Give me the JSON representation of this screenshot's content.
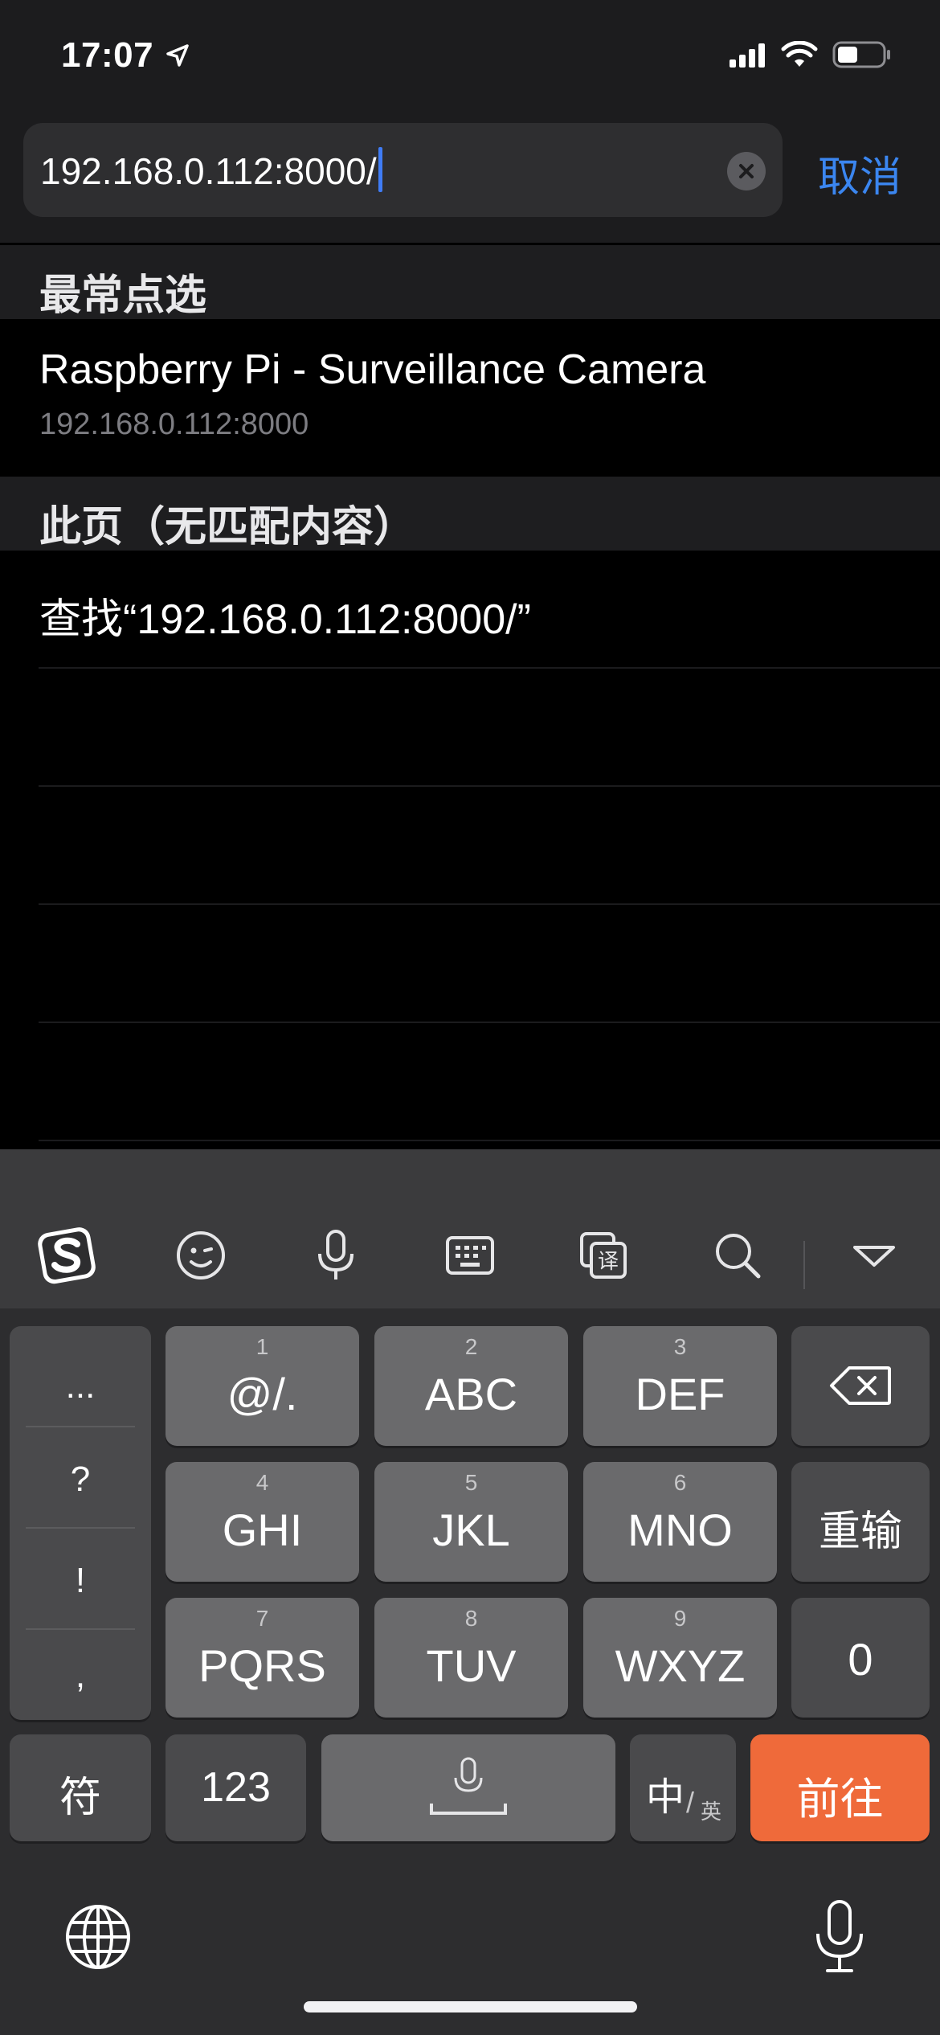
{
  "status_bar": {
    "time": "17:07",
    "battery_level": 0.45
  },
  "search": {
    "url_text": "192.168.0.112:8000/",
    "cancel_label": "取消"
  },
  "sections": {
    "top_hits_header": "最常点选",
    "top_hit": {
      "title": "Raspberry Pi - Surveillance Camera",
      "subtitle": "192.168.0.112:8000"
    },
    "on_page_header": "此页（无匹配内容）",
    "find_on_page": "查找“192.168.0.112:8000/”"
  },
  "keyboard": {
    "side_symbols": [
      "...",
      "?",
      "!",
      ","
    ],
    "keys": [
      {
        "num": "1",
        "label": "@/."
      },
      {
        "num": "2",
        "label": "ABC"
      },
      {
        "num": "3",
        "label": "DEF"
      },
      {
        "num": "4",
        "label": "GHI"
      },
      {
        "num": "5",
        "label": "JKL"
      },
      {
        "num": "6",
        "label": "MNO"
      },
      {
        "num": "7",
        "label": "PQRS"
      },
      {
        "num": "8",
        "label": "TUV"
      },
      {
        "num": "9",
        "label": "WXYZ"
      }
    ],
    "reenter_label": "重输",
    "zero_label": "0",
    "symbol_label": "符",
    "numeric_label": "123",
    "lang_primary": "中",
    "lang_secondary": "英",
    "go_label": "前往",
    "accent_color": "#ef6a3a"
  },
  "toolbar_icons": [
    "sogou-logo-icon",
    "emoji-icon",
    "microphone-icon",
    "keyboard-icon",
    "translate-icon",
    "search-icon",
    "collapse-icon"
  ],
  "colors": {
    "link_blue": "#3b86f0",
    "caret_blue": "#3f7cf5"
  }
}
